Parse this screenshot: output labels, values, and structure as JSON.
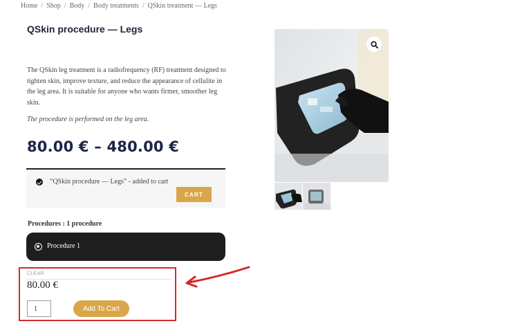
{
  "breadcrumb": {
    "items": [
      "Home",
      "Shop",
      "Body",
      "Body treatments",
      "QSkin treatment — Legs"
    ],
    "separator": "/"
  },
  "product": {
    "title": "QSkin procedure — Legs",
    "description": "The QSkin leg treatment is a radiofrequency (RF) treatment designed to tighten skin, improve texture, and reduce the appearance of cellulite in the leg area. It is suitable for anyone who wants firmer, smoother leg skin.",
    "note": "The procedure is performed on the leg area.",
    "price_range": "80.00 € – 480.00 €"
  },
  "notice": {
    "message": "“QSkin procedure — Legs” - added to cart",
    "button_label": "CART",
    "icon": "check-circle-icon"
  },
  "variations": {
    "label": "Procedures : 1 procedure",
    "option_label": "Procedure 1",
    "selected": true,
    "clear_label": "CLEAR",
    "price": "80.00 €"
  },
  "cart": {
    "quantity": "1",
    "add_label": "Add To Cart"
  },
  "gallery": {
    "zoom_icon": "magnifier-icon",
    "thumbnail_count": 2
  },
  "colors": {
    "accent": "#d9a74a",
    "price": "#1c2446",
    "highlight": "#d42a2a",
    "option_bg": "#1e1e1e"
  }
}
